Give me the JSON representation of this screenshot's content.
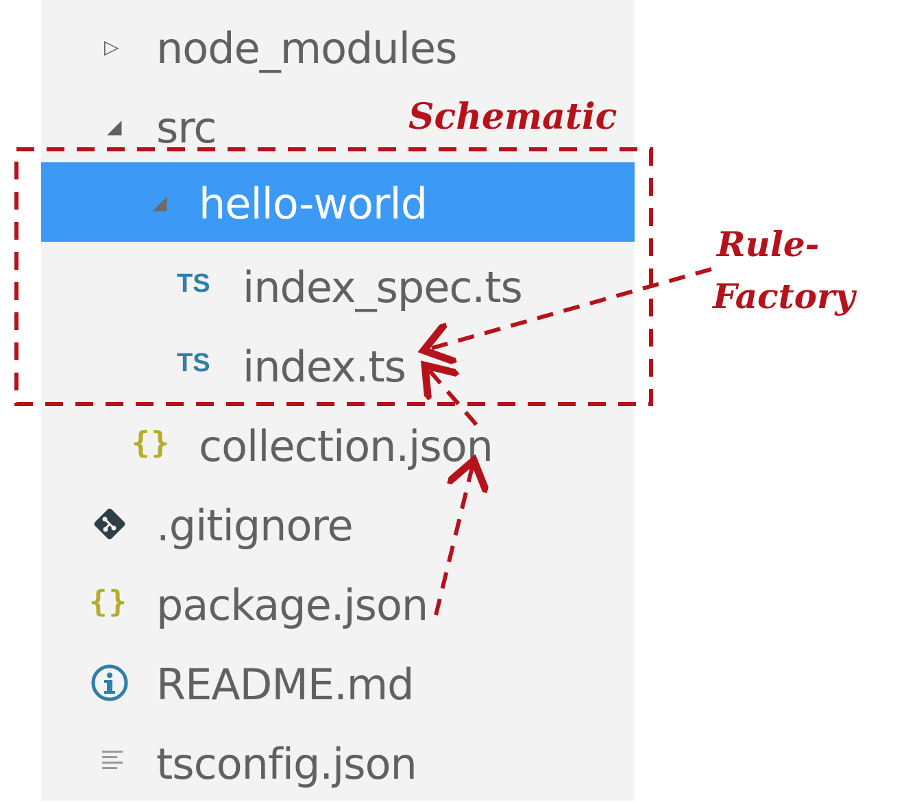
{
  "file_tree": {
    "items": [
      {
        "label": "node_modules",
        "twisty": "▷",
        "icon": "none"
      },
      {
        "label": "src",
        "twisty": "◢",
        "icon": "none"
      },
      {
        "label": "hello-world",
        "twisty": "◢",
        "icon": "none",
        "selected": true
      },
      {
        "label": "index_spec.ts",
        "icon": "typescript-file-icon",
        "icon_text": "TS"
      },
      {
        "label": "index.ts",
        "icon": "typescript-file-icon",
        "icon_text": "TS"
      },
      {
        "label": "collection.json",
        "icon": "json-file-icon",
        "icon_text": "{}"
      },
      {
        "label": ".gitignore",
        "icon": "git-icon"
      },
      {
        "label": "package.json",
        "icon": "json-file-icon",
        "icon_text": "{}"
      },
      {
        "label": "README.md",
        "icon": "info-icon"
      },
      {
        "label": "tsconfig.json",
        "icon": "settings-file-icon"
      }
    ]
  },
  "annotations": {
    "schematic_label": "Schematic",
    "rule_factory_label_line1": "Rule-",
    "rule_factory_label_line2": "Factory"
  },
  "colors": {
    "sidebar_bg": "#f3f3f3",
    "selection": "#3c99f5",
    "annotation": "#b5121b",
    "ts_icon": "#2f7fa8",
    "json_icon": "#b2ad2a",
    "text": "#616161"
  }
}
